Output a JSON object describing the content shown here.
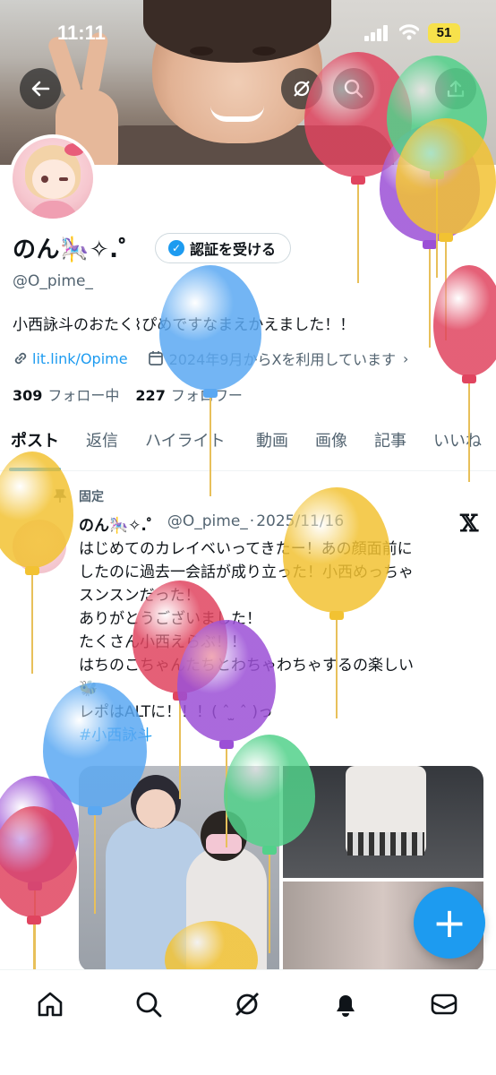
{
  "status_bar": {
    "time": "11:11",
    "battery": "51"
  },
  "profile": {
    "name": "のん🎠✧.゜",
    "verify_button": "認証を受ける",
    "handle": "@O_pime_",
    "bio": "小西詠斗のおたく⌇ぴめですなまえかえました！！",
    "link": "lit.link/Opime",
    "joined": "2024年9月からXを利用しています",
    "following_count": "309",
    "following_label": "フォロー中",
    "followers_count": "227",
    "followers_label": "フォロワー"
  },
  "tabs": [
    "ポスト",
    "返信",
    "ハイライト",
    "動画",
    "画像",
    "記事",
    "いいね"
  ],
  "active_tab": 0,
  "post": {
    "pinned_label": "固定",
    "author_name": "のん🎠✧.゜",
    "author_handle": "@O_pime_",
    "date": "2025/11/16",
    "lines": [
      "はじめてのカレイベいってきたー！あの顔面前に",
      "したのに過去一会話が成り立った！小西めっちゃ",
      "スンスンだった！",
      "ありがとうございました！",
      "たくさん小西えらぶ！！",
      "はちのこちゃんたちとわちゃわちゃするの楽しい",
      "🐝",
      "レポはALTに！！！( ˆ ̫ ˆ )っ"
    ],
    "hashtag": "#小西詠斗"
  },
  "icons": {
    "back": "back-arrow-icon",
    "search": "search-icon",
    "share": "share-icon",
    "grok": "grok-icon",
    "pin": "pin-icon",
    "link": "link-icon",
    "calendar": "calendar-icon",
    "x_logo": "x-logo-icon",
    "compose": "compose-plus-icon",
    "nav": [
      "home-icon",
      "search-icon",
      "grok-icon",
      "notifications-icon",
      "messages-icon"
    ]
  },
  "colors": {
    "accent": "#1d9bf0",
    "text": "#0f1419",
    "muted": "#536471"
  }
}
